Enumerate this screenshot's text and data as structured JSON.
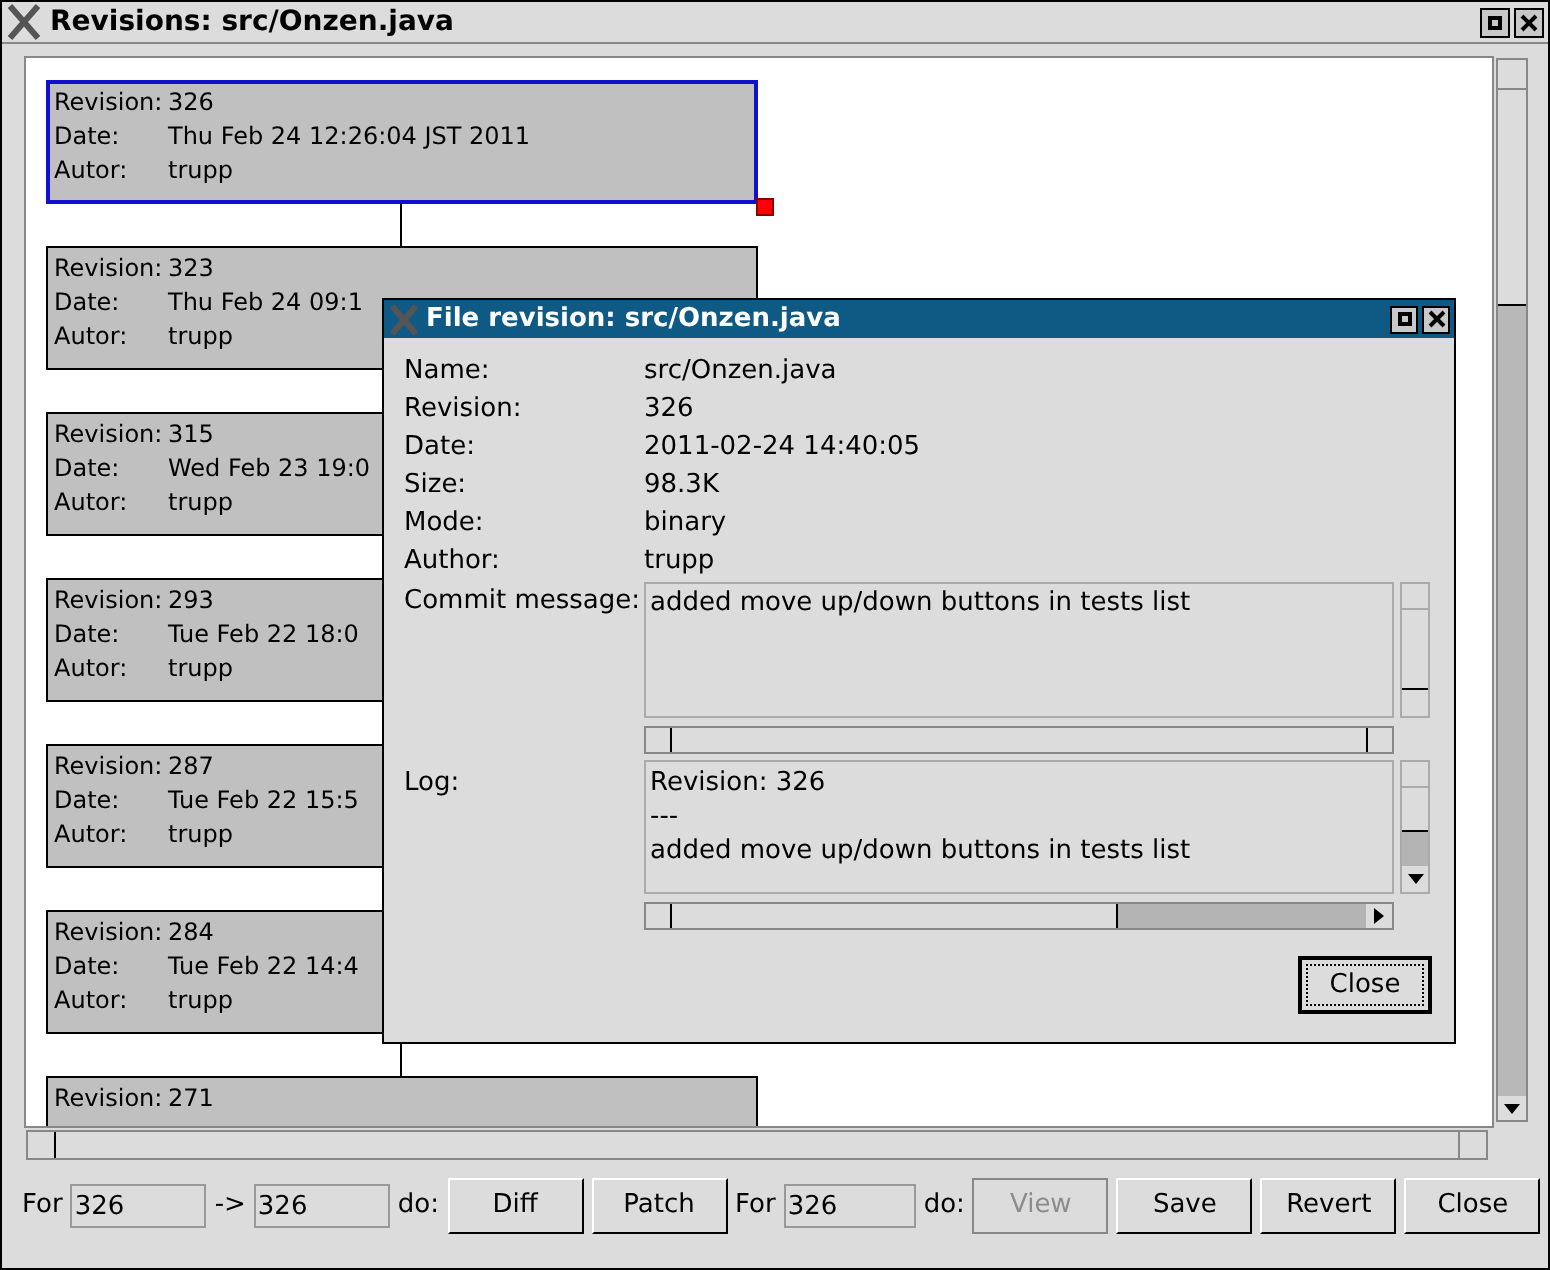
{
  "window": {
    "title": "Revisions: src/Onzen.java"
  },
  "revisions": [
    {
      "revision_label": "Revision:",
      "revision": "326",
      "date_label": "Date:",
      "date": "Thu Feb 24 12:26:04 JST 2011",
      "author_label": "Autor:",
      "author": "trupp",
      "selected": true
    },
    {
      "revision_label": "Revision:",
      "revision": "323",
      "date_label": "Date:",
      "date": "Thu Feb 24 09:1",
      "author_label": "Autor:",
      "author": "trupp",
      "selected": false
    },
    {
      "revision_label": "Revision:",
      "revision": "315",
      "date_label": "Date:",
      "date": "Wed Feb 23 19:0",
      "author_label": "Autor:",
      "author": "trupp",
      "selected": false
    },
    {
      "revision_label": "Revision:",
      "revision": "293",
      "date_label": "Date:",
      "date": "Tue Feb 22 18:0",
      "author_label": "Autor:",
      "author": "trupp",
      "selected": false
    },
    {
      "revision_label": "Revision:",
      "revision": "287",
      "date_label": "Date:",
      "date": "Tue Feb 22 15:5",
      "author_label": "Autor:",
      "author": "trupp",
      "selected": false
    },
    {
      "revision_label": "Revision:",
      "revision": "284",
      "date_label": "Date:",
      "date": "Tue Feb 22 14:4",
      "author_label": "Autor:",
      "author": "trupp",
      "selected": false
    },
    {
      "revision_label": "Revision:",
      "revision": "271",
      "selected": false
    }
  ],
  "bottom_bar": {
    "for_label": "For",
    "from": "326",
    "arrow": "->",
    "to": "326",
    "do_label": "do:",
    "for_label_2": "For",
    "revision": "326",
    "do_label_2": "do:"
  },
  "range_buttons": [
    {
      "label": "Diff",
      "disabled": false
    },
    {
      "label": "Patch",
      "disabled": false
    }
  ],
  "revision_buttons": [
    {
      "label": "View",
      "disabled": true
    },
    {
      "label": "Save",
      "disabled": false
    },
    {
      "label": "Revert",
      "disabled": false
    },
    {
      "label": "Close",
      "disabled": false
    }
  ],
  "dialog": {
    "title": "File revision: src/Onzen.java",
    "fields": [
      {
        "label": "Name:",
        "value": "src/Onzen.java"
      },
      {
        "label": "Revision:",
        "value": "326"
      },
      {
        "label": "Date:",
        "value": "2011-02-24 14:40:05"
      },
      {
        "label": "Size:",
        "value": "98.3K"
      },
      {
        "label": "Mode:",
        "value": "binary"
      },
      {
        "label": "Author:",
        "value": "trupp"
      }
    ],
    "commit_label": "Commit message:",
    "commit_message": "added move up/down buttons in tests list",
    "log_label": "Log:",
    "log_lines": [
      "Revision: 326",
      "---",
      "added move up/down buttons in tests list"
    ],
    "close_button": "Close"
  }
}
